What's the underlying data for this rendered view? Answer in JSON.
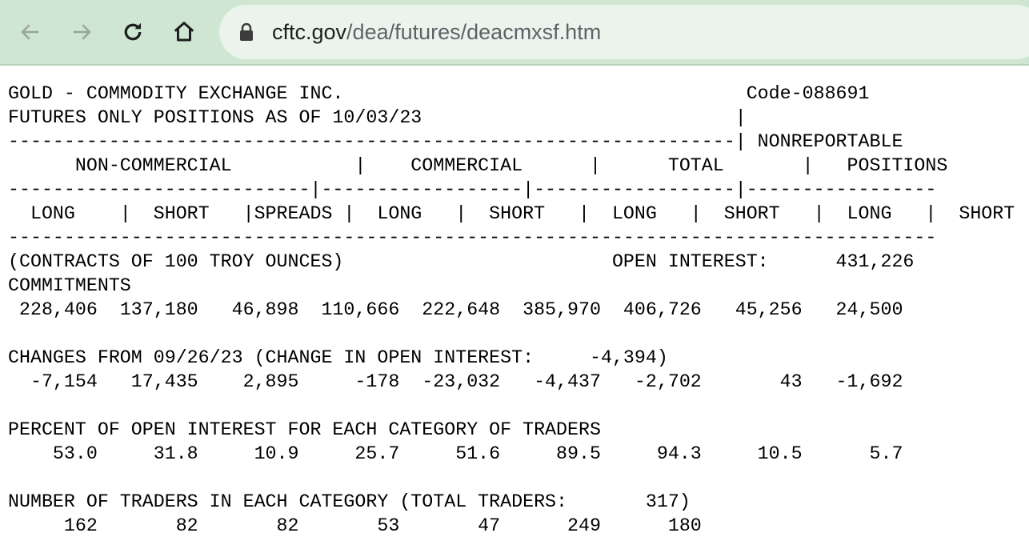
{
  "browser": {
    "url_host": "cftc.gov",
    "url_path": "/dea/futures/deacmxsf.htm"
  },
  "report": {
    "lines": [
      "GOLD - COMMODITY EXCHANGE INC.                                    Code-088691",
      "FUTURES ONLY POSITIONS AS OF 10/03/23                            |",
      "-----------------------------------------------------------------| NONREPORTABLE",
      "      NON-COMMERCIAL           |    COMMERCIAL      |      TOTAL       |   POSITIONS",
      "---------------------------|------------------|------------------|-----------------",
      "  LONG    |  SHORT   |SPREADS |  LONG   |  SHORT   |  LONG   |  SHORT   |  LONG   |  SHORT",
      "-----------------------------------------------------------------------------------",
      "(CONTRACTS OF 100 TROY OUNCES)                        OPEN INTEREST:      431,226",
      "COMMITMENTS",
      " 228,406  137,180   46,898  110,666  222,648  385,970  406,726   45,256   24,500",
      "",
      "CHANGES FROM 09/26/23 (CHANGE IN OPEN INTEREST:     -4,394)",
      "  -7,154   17,435    2,895     -178  -23,032   -4,437   -2,702       43   -1,692",
      "",
      "PERCENT OF OPEN INTEREST FOR EACH CATEGORY OF TRADERS",
      "    53.0     31.8     10.9     25.7     51.6     89.5     94.3     10.5      5.7",
      "",
      "NUMBER OF TRADERS IN EACH CATEGORY (TOTAL TRADERS:       317)",
      "     162       82       82       53       47      249      180"
    ]
  },
  "icons": {
    "back": "arrow-left",
    "forward": "arrow-right",
    "reload": "reload",
    "home": "home",
    "lock": "lock"
  },
  "colors": {
    "toolbar_bg": "#cfe6d3",
    "omnibox_bg": "#eaf4ec"
  }
}
